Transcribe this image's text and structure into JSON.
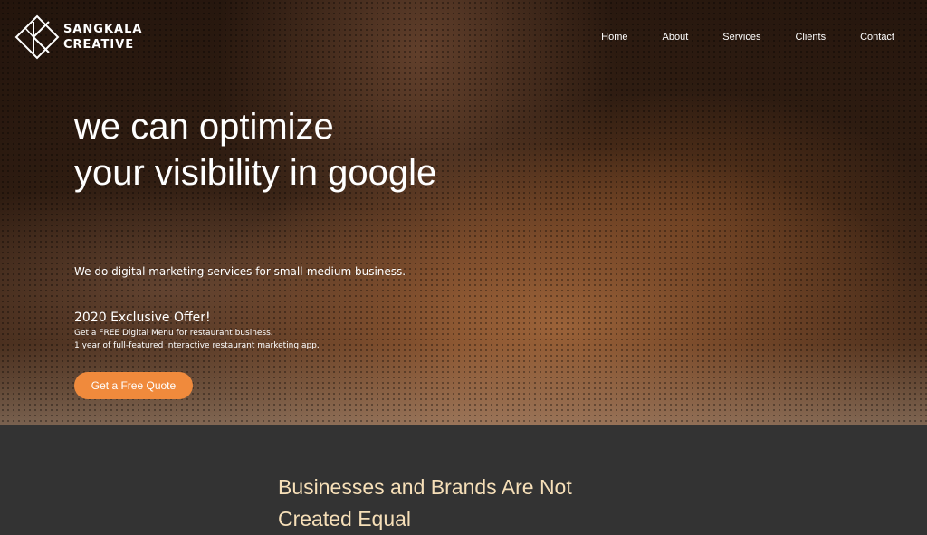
{
  "brand": {
    "line1": "SANGKALA",
    "line2": "CREATIVE",
    "logo_icon": "diamond-k-logo-icon"
  },
  "nav": {
    "items": [
      {
        "label": "Home"
      },
      {
        "label": "About"
      },
      {
        "label": "Services"
      },
      {
        "label": "Clients"
      },
      {
        "label": "Contact"
      }
    ]
  },
  "hero": {
    "headline_line1": "we can optimize",
    "headline_line2": "your visibility in google",
    "tagline": "We do digital marketing services for small-medium business.",
    "offer_title": "2020 Exclusive Offer!",
    "offer_line1": "Get a FREE Digital Menu for restaurant business.",
    "offer_line2": "1 year of full-featured interactive restaurant marketing app.",
    "cta_label": "Get a Free Quote"
  },
  "section": {
    "heading_line1": "Businesses and Brands Are Not",
    "heading_line2": "Created Equal"
  },
  "colors": {
    "accent": "#f08a3c",
    "heading_cream": "#f6dfb8",
    "section_bg": "#333333"
  }
}
